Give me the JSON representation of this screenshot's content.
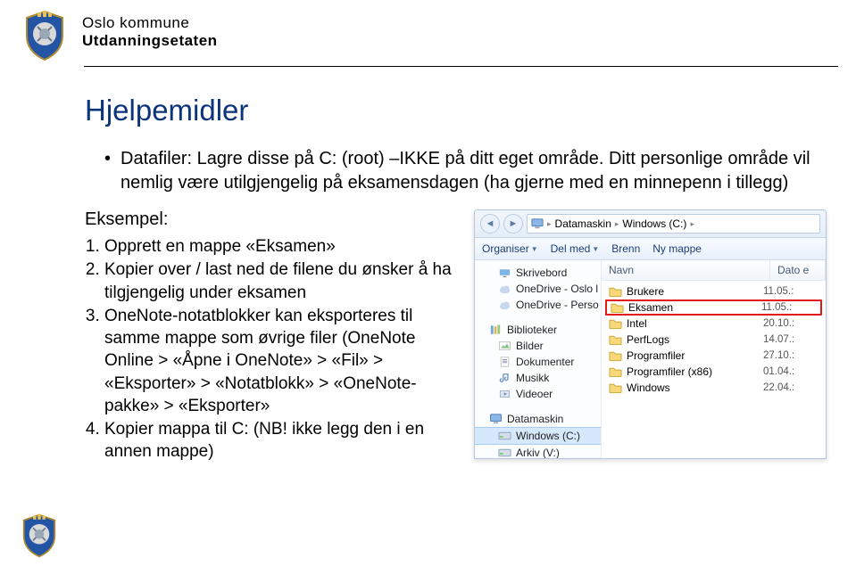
{
  "header": {
    "line1": "Oslo kommune",
    "line2": "Utdanningsetaten"
  },
  "title": "Hjelpemidler",
  "bullets": [
    "Datafiler: Lagre disse på C: (root) –IKKE på ditt eget område. Ditt personlige område vil nemlig være utilgjengelig på eksamensdagen (ha gjerne med en minnepenn i tillegg)"
  ],
  "example_label": "Eksempel:",
  "numbered": [
    "Opprett en mappe «Eksamen»",
    "Kopier over / last ned de filene du ønsker å ha tilgjengelig under eksamen",
    "OneNote-notatblokker kan eksporteres til samme mappe som øvrige filer (OneNote Online > «Åpne i OneNote» > «Fil» > «Eksporter» > «Notatblokk» > «OneNote-pakke» > «Eksporter»",
    "Kopier mappa til C: (NB! ikke legg den i en annen mappe)"
  ],
  "explorer": {
    "breadcrumb": {
      "part1": "Datamaskin",
      "part2": "Windows (C:)"
    },
    "toolbar": {
      "organiser": "Organiser",
      "delmed": "Del med",
      "brenn": "Brenn",
      "nymappe": "Ny mappe"
    },
    "nav": {
      "skrivebord": "Skrivebord",
      "onedrive_oslo": "OneDrive - Oslo l",
      "onedrive_perso": "OneDrive - Perso",
      "biblioteker": "Biblioteker",
      "bilder": "Bilder",
      "dokumenter": "Dokumenter",
      "musikk": "Musikk",
      "videoer": "Videoer",
      "datamaskin": "Datamaskin",
      "windows_c": "Windows (C:)",
      "arkiv_v": "Arkiv (V:)"
    },
    "columns": {
      "navn": "Navn",
      "dato": "Dato e"
    },
    "rows": [
      {
        "name": "Brukere",
        "date": "11.05.:"
      },
      {
        "name": "Eksamen",
        "date": "11.05.:",
        "highlight": true
      },
      {
        "name": "Intel",
        "date": "20.10.:"
      },
      {
        "name": "PerfLogs",
        "date": "14.07.:"
      },
      {
        "name": "Programfiler",
        "date": "27.10.:"
      },
      {
        "name": "Programfiler (x86)",
        "date": "01.04.:"
      },
      {
        "name": "Windows",
        "date": "22.04.:"
      }
    ]
  }
}
